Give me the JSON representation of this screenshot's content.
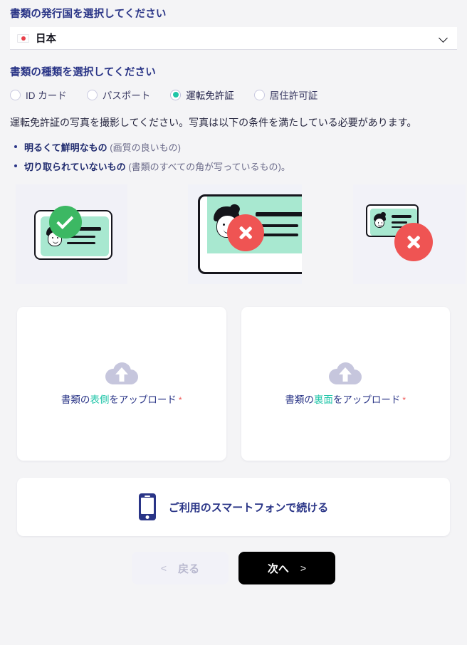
{
  "country_section": {
    "title": "書類の発行国を選択してください",
    "selected_country": "日本",
    "flag_icon": "japan-flag-icon",
    "chevron_icon": "chevron-down-icon"
  },
  "doctype_section": {
    "title": "書類の種類を選択してください",
    "options": [
      {
        "label": "ID カード",
        "selected": false
      },
      {
        "label": "パスポート",
        "selected": false
      },
      {
        "label": "運転免許証",
        "selected": true
      },
      {
        "label": "居住許可証",
        "selected": false
      }
    ]
  },
  "instructions": {
    "paragraph": "運転免許証の写真を撮影してください。写真は以下の条件を満たしている必要があります。",
    "bullets": [
      {
        "strong": "明るくて鮮明なもの",
        "rest": " (画質の良いもの)"
      },
      {
        "strong": "切り取られていないもの",
        "rest": " (書類のすべての角が写っているもの)。"
      }
    ]
  },
  "examples": [
    {
      "name": "good-example",
      "status": "ok",
      "badge_icon": "check-circle-icon"
    },
    {
      "name": "cropped-example",
      "status": "error",
      "badge_icon": "x-circle-icon"
    },
    {
      "name": "too-far-example",
      "status": "error",
      "badge_icon": "x-circle-icon"
    }
  ],
  "uploads": [
    {
      "prefix": "書類の",
      "highlight": "表側",
      "suffix": "をアップロード",
      "required_mark": "*",
      "icon": "cloud-upload-icon"
    },
    {
      "prefix": "書類の",
      "highlight": "裏面",
      "suffix": "をアップロード",
      "required_mark": "*",
      "icon": "cloud-upload-icon"
    }
  ],
  "smartphone_bar": {
    "label": "ご利用のスマートフォンで続ける",
    "icon": "smartphone-icon"
  },
  "footer": {
    "back_arrow": "<",
    "back_label": "戻る",
    "next_label": "次へ",
    "next_arrow": ">"
  },
  "colors": {
    "heading_navy": "#2a3587",
    "accent_teal": "#1fc5a8",
    "required_red": "#ef5453",
    "success_green": "#3cb863",
    "error_red": "#ef5453",
    "page_bg": "#f4f4f6",
    "next_button_bg": "#000000"
  }
}
